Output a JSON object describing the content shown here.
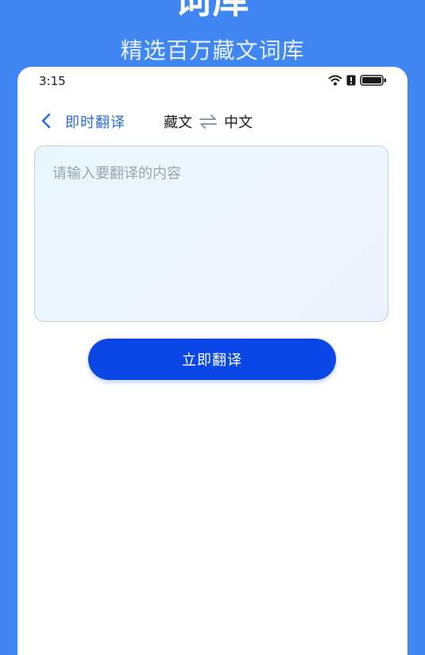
{
  "promo": {
    "title": "词库",
    "subtitle": "精选百万藏文词库"
  },
  "status_bar": {
    "time": "3:15",
    "icons": [
      "wifi-icon",
      "alert-icon",
      "battery-icon"
    ]
  },
  "nav": {
    "back_icon": "chevron-left-icon",
    "title": "即时翻译",
    "source_lang": "藏文",
    "swap_icon": "swap-arrows-icon",
    "target_lang": "中文"
  },
  "input": {
    "placeholder": "请输入要翻译的内容",
    "value": ""
  },
  "action": {
    "translate_label": "立即翻译"
  },
  "colors": {
    "background": "#3f86f3",
    "accent": "#2d6bd6",
    "button": "#0b47e6"
  }
}
